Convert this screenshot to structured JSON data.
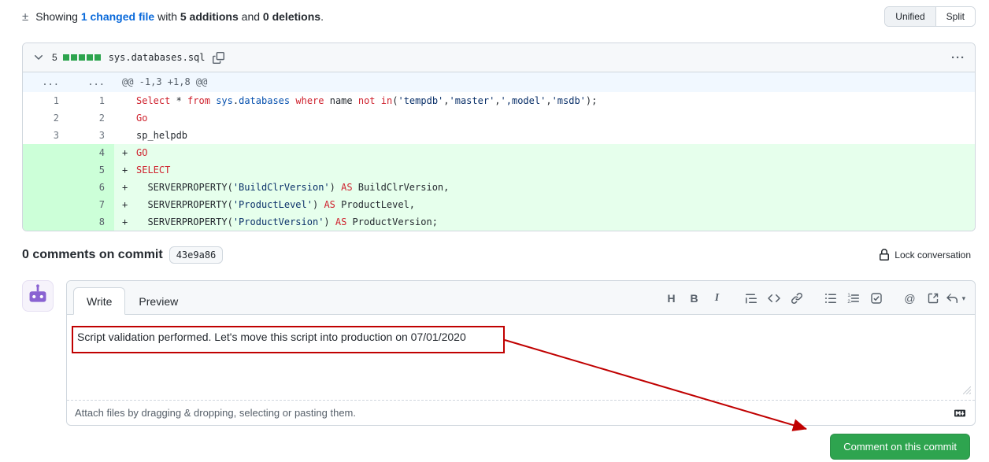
{
  "colors": {
    "link_blue": "#0969da",
    "annotation": "#c00000",
    "button_green": "#2ea44f",
    "diffstat_green": "#2da44e",
    "added_bg": "#e6ffec",
    "added_num_bg": "#ccffd8",
    "hunk_bg": "#f1f8ff",
    "keyword": "#cf222e",
    "string": "#0a3069",
    "entity": "#0550ae"
  },
  "icons": {
    "plusminus": "±",
    "kebab": "···"
  },
  "summary": {
    "showing": "Showing ",
    "changed_file_link": "1 changed file",
    "with": " with ",
    "additions": "5 additions",
    "and": " and ",
    "deletions": "0 deletions",
    "period": "."
  },
  "view_toggle": {
    "options": [
      {
        "label": "Unified",
        "selected": true
      },
      {
        "label": "Split",
        "selected": false
      }
    ]
  },
  "file": {
    "additions_count": "5",
    "diffstat_blocks": 5,
    "filename": "sys.databases.sql",
    "hunk": {
      "old_marker": "...",
      "new_marker": "...",
      "header": "@@ -1,3 +1,8 @@"
    },
    "rows": [
      {
        "old": "1",
        "new": "1",
        "type": "context",
        "sign": "",
        "tokens": [
          [
            "k",
            "Select"
          ],
          [
            "p",
            " * "
          ],
          [
            "k",
            "from"
          ],
          [
            "p",
            " "
          ],
          [
            "e",
            "sys"
          ],
          [
            "p",
            "."
          ],
          [
            "e",
            "databases"
          ],
          [
            "p",
            " "
          ],
          [
            "k",
            "where"
          ],
          [
            "p",
            " name "
          ],
          [
            "k",
            "not"
          ],
          [
            "p",
            " "
          ],
          [
            "k",
            "in"
          ],
          [
            "p",
            "("
          ],
          [
            "s",
            "'tempdb'"
          ],
          [
            "p",
            ","
          ],
          [
            "s",
            "'master'"
          ],
          [
            "p",
            ","
          ],
          [
            "s",
            "',model'"
          ],
          [
            "p",
            ","
          ],
          [
            "s",
            "'msdb'"
          ],
          [
            "p",
            ");"
          ]
        ]
      },
      {
        "old": "2",
        "new": "2",
        "type": "context",
        "sign": "",
        "tokens": [
          [
            "k",
            "Go"
          ]
        ]
      },
      {
        "old": "3",
        "new": "3",
        "type": "context",
        "sign": "",
        "tokens": [
          [
            "p",
            "sp_helpdb"
          ]
        ]
      },
      {
        "old": "",
        "new": "4",
        "type": "add",
        "sign": "+",
        "tokens": [
          [
            "k",
            "GO"
          ]
        ]
      },
      {
        "old": "",
        "new": "5",
        "type": "add",
        "sign": "+",
        "tokens": [
          [
            "k",
            "SELECT"
          ]
        ]
      },
      {
        "old": "",
        "new": "6",
        "type": "add",
        "sign": "+",
        "tokens": [
          [
            "p",
            "  SERVERPROPERTY("
          ],
          [
            "s",
            "'BuildClrVersion'"
          ],
          [
            "p",
            ") "
          ],
          [
            "k",
            "AS"
          ],
          [
            "p",
            " BuildClrVersion,"
          ]
        ]
      },
      {
        "old": "",
        "new": "7",
        "type": "add",
        "sign": "+",
        "tokens": [
          [
            "p",
            "  SERVERPROPERTY("
          ],
          [
            "s",
            "'ProductLevel'"
          ],
          [
            "p",
            ") "
          ],
          [
            "k",
            "AS"
          ],
          [
            "p",
            " ProductLevel,"
          ]
        ]
      },
      {
        "old": "",
        "new": "8",
        "type": "add",
        "sign": "+",
        "tokens": [
          [
            "p",
            "  SERVERPROPERTY("
          ],
          [
            "s",
            "'ProductVersion'"
          ],
          [
            "p",
            ") "
          ],
          [
            "k",
            "AS"
          ],
          [
            "p",
            " ProductVersion;"
          ]
        ]
      }
    ]
  },
  "comments": {
    "heading": "0 comments on commit",
    "sha": "43e9a86",
    "lock_label": "Lock conversation"
  },
  "form": {
    "tabs": [
      {
        "label": "Write",
        "active": true
      },
      {
        "label": "Preview",
        "active": false
      }
    ],
    "toolbar": [
      {
        "name": "heading",
        "glyph": "H"
      },
      {
        "name": "bold",
        "glyph": "B"
      },
      {
        "name": "italic",
        "glyph": "I"
      },
      {
        "name": "quote",
        "group": true
      },
      {
        "name": "code"
      },
      {
        "name": "link"
      },
      {
        "name": "unordered-list",
        "group": true
      },
      {
        "name": "ordered-list"
      },
      {
        "name": "task-list"
      },
      {
        "name": "mention",
        "glyph": "@",
        "group": true
      },
      {
        "name": "cross-reference"
      },
      {
        "name": "saved-replies",
        "caret": "▾"
      }
    ],
    "comment_text": "Script validation performed. Let's move this script into production on 07/01/2020",
    "attach_hint": "Attach files by dragging & dropping, selecting or pasting them.",
    "submit_label": "Comment on this commit"
  }
}
